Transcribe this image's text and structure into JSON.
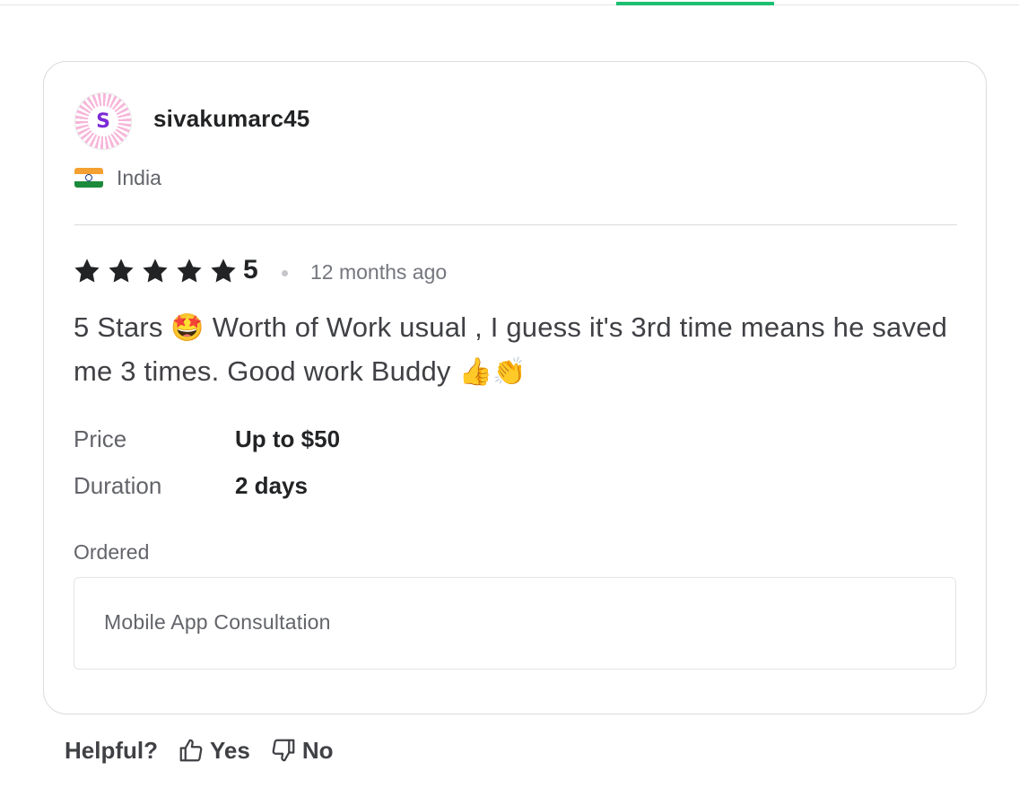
{
  "review": {
    "username": "sivakumarc45",
    "avatar_initial": "S",
    "country": "India",
    "rating": "5",
    "stars_filled": 5,
    "stars_total": 5,
    "time_ago": "12 months ago",
    "text_part1": "5 Stars ",
    "emoji_star_struck": "🤩",
    "text_part2": " Worth of Work usual , I guess it's 3rd time means he saved me 3 times. Good work Buddy ",
    "emoji_thumbs_up": "👍",
    "emoji_clapping": "👏",
    "price_label": "Price",
    "price_value": "Up to $50",
    "duration_label": "Duration",
    "duration_value": "2 days",
    "ordered_label": "Ordered",
    "ordered_item": "Mobile App Consultation"
  },
  "feedback": {
    "helpful_label": "Helpful?",
    "yes_label": "Yes",
    "no_label": "No"
  },
  "colors": {
    "accent_green": "#1dbf73",
    "star_color": "#222325",
    "avatar_initial_color": "#7b2bd6",
    "avatar_ray_color": "#f7b6da"
  },
  "icons": {
    "star": "star-icon",
    "flag": "india-flag-icon",
    "thumbs_up": "thumbs-up-icon",
    "thumbs_down": "thumbs-down-icon"
  }
}
